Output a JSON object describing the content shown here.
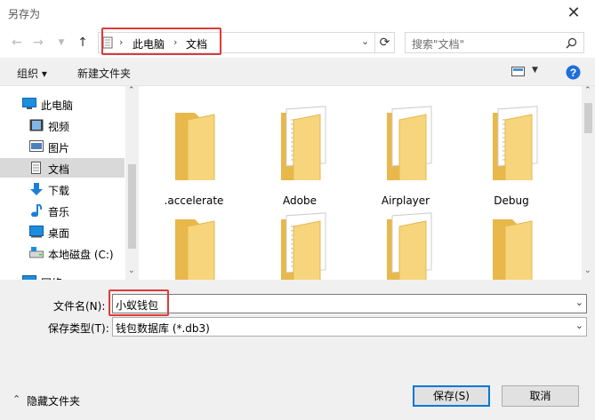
{
  "window": {
    "title": "另存为"
  },
  "nav": {
    "breadcrumb": [
      "此电脑",
      "文档"
    ],
    "search_placeholder": "搜索\"文档\""
  },
  "toolbar": {
    "organize": "组织 ▾",
    "new_folder": "新建文件夹"
  },
  "sidebar": {
    "items": [
      {
        "label": "此电脑",
        "icon": "pc-icon"
      },
      {
        "label": "视频",
        "icon": "video-icon"
      },
      {
        "label": "图片",
        "icon": "picture-icon"
      },
      {
        "label": "文档",
        "icon": "document-icon",
        "selected": true
      },
      {
        "label": "下载",
        "icon": "download-icon"
      },
      {
        "label": "音乐",
        "icon": "music-icon"
      },
      {
        "label": "桌面",
        "icon": "desktop-icon"
      },
      {
        "label": "本地磁盘 (C:)",
        "icon": "drive-icon"
      },
      {
        "label": "网络",
        "icon": "network-icon"
      }
    ]
  },
  "folders": [
    {
      "name": ".accelerate",
      "type": "empty"
    },
    {
      "name": "Adobe",
      "type": "docs"
    },
    {
      "name": "Airplayer",
      "type": "images"
    },
    {
      "name": "Debug",
      "type": "docs"
    },
    {
      "name": "",
      "type": "empty"
    },
    {
      "name": "",
      "type": "docs"
    },
    {
      "name": "",
      "type": "images"
    },
    {
      "name": "",
      "type": "empty"
    }
  ],
  "form": {
    "filename_label": "文件名(N):",
    "filename_value": "小蚁钱包",
    "filetype_label": "保存类型(T):",
    "filetype_value": "钱包数据库 (*.db3)"
  },
  "footer": {
    "hide_folders": "隐藏文件夹",
    "save": "保存(S)",
    "cancel": "取消"
  },
  "colors": {
    "highlight": "#e03a3a",
    "folder": "#f7d57c",
    "accent": "#0078d7"
  }
}
